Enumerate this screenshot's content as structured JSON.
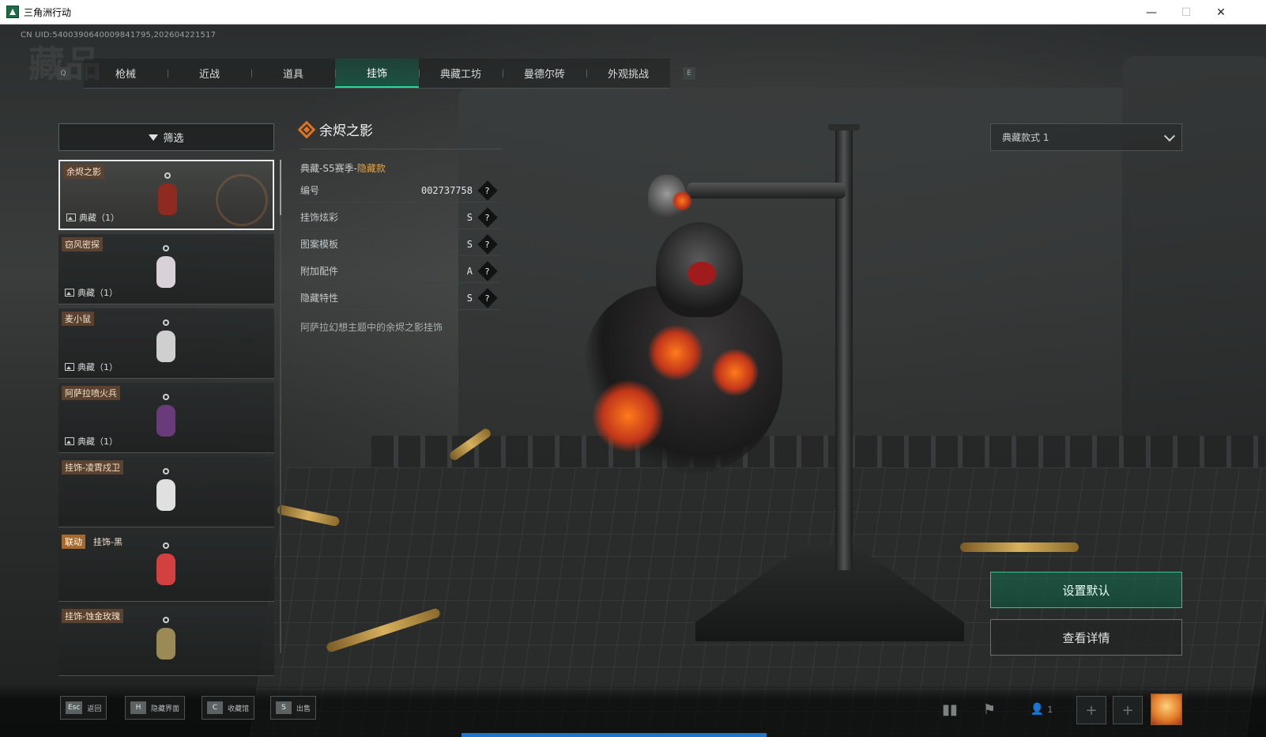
{
  "window": {
    "title": "三角洲行动",
    "minimize": "—",
    "maximize": "☐",
    "close": "✕"
  },
  "uid": "CN UID:5400390640009841795,202604221517",
  "page_watermark": "藏品",
  "tab_keys": {
    "prev": "Q",
    "next": "E"
  },
  "tabs": [
    {
      "label": "枪械",
      "active": false
    },
    {
      "label": "近战",
      "active": false
    },
    {
      "label": "道具",
      "active": false
    },
    {
      "label": "挂饰",
      "active": true
    },
    {
      "label": "典藏工坊",
      "active": false
    },
    {
      "label": "曼德尔砖",
      "active": false
    },
    {
      "label": "外观挑战",
      "active": false
    }
  ],
  "filter": {
    "label": "筛选"
  },
  "items": [
    {
      "name": "余烬之影",
      "badge": "",
      "count": "典藏（1）",
      "selected": true,
      "color": "#8e2a20"
    },
    {
      "name": "窃风密探",
      "badge": "",
      "count": "典藏（1）",
      "selected": false,
      "color": "#d9d0d8"
    },
    {
      "name": "麦小鼠",
      "badge": "",
      "count": "典藏（1）",
      "selected": false,
      "color": "#cfcfcf"
    },
    {
      "name": "阿萨拉喷火兵",
      "badge": "",
      "count": "典藏（1）",
      "selected": false,
      "color": "#6a3b7a"
    },
    {
      "name": "挂饰-凌霄戍卫",
      "badge": "",
      "count": "",
      "selected": false,
      "color": "#e0e0e0"
    },
    {
      "name": "挂饰-黑",
      "badge": "联动",
      "count": "",
      "selected": false,
      "color": "#d24040"
    },
    {
      "name": "挂饰-蚀金玫瑰",
      "badge": "",
      "count": "",
      "selected": false,
      "color": "#9b8a55"
    }
  ],
  "detail": {
    "title": "余烬之影",
    "season_prefix": "典藏-S5赛季-",
    "season_highlight": "隐藏款",
    "attributes": [
      {
        "label": "编号",
        "value": "002737758",
        "help": "?"
      },
      {
        "label": "挂饰炫彩",
        "value": "S",
        "help": "?"
      },
      {
        "label": "图案模板",
        "value": "S",
        "help": "?"
      },
      {
        "label": "附加配件",
        "value": "A",
        "help": "?"
      },
      {
        "label": "隐藏特性",
        "value": "S",
        "help": "?"
      }
    ],
    "description": "阿萨拉幻想主题中的余烬之影挂饰"
  },
  "variant_select": {
    "value": "典藏款式 1"
  },
  "actions": {
    "set_default": "设置默认",
    "view_detail": "查看详情"
  },
  "hotkeys": [
    {
      "key": "Esc",
      "label": "返回"
    },
    {
      "key": "H",
      "label": "隐藏界面"
    },
    {
      "key": "C",
      "label": "收藏馆"
    },
    {
      "key": "S",
      "label": "出售"
    }
  ],
  "bottom_right": {
    "players_count": "1",
    "slot_add": "+"
  },
  "colors": {
    "accent": "#2fd39a",
    "accent_dark": "#176e52",
    "highlight": "#e7a33a",
    "name_tag": "#5b4130",
    "badge_tag": "#a86a2a",
    "progress": "#1f76c9"
  }
}
